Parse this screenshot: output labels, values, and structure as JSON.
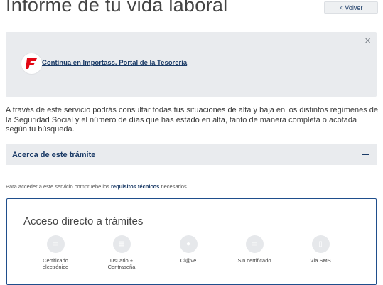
{
  "header": {
    "title": "Informe de tu vida laboral",
    "back_label": "< Volver"
  },
  "notice": {
    "link_text": "Continua en Importass. Portal de la Tesorería",
    "close_icon": "×"
  },
  "description": "A través de este servicio podrás consultar todas tus situaciones de alta y baja en los distintos regímenes de la Seguridad Social y el número de días que has estado en alta, tanto de manera completa o acotada según tu búsqueda.",
  "accordion": {
    "label": "Acerca de este trámite"
  },
  "requirements": {
    "prefix": "Para acceder a este servicio compruebe los ",
    "link": "requisitos técnicos",
    "suffix": " necesarios."
  },
  "access": {
    "title": "Acceso directo a trámites",
    "options": [
      {
        "label": "Certificado electrónico",
        "icon": "certificate-icon",
        "glyph": "▭"
      },
      {
        "label": "Usuario + Contraseña",
        "icon": "user-password-icon",
        "glyph": "▤"
      },
      {
        "label": "Cl@ve",
        "icon": "clave-icon",
        "glyph": "●"
      },
      {
        "label": "Sin certificado",
        "icon": "no-certificate-icon",
        "glyph": "▭"
      },
      {
        "label": "Vía SMS",
        "icon": "sms-icon",
        "glyph": "▯"
      }
    ]
  },
  "colors": {
    "brand_red": "#e30613",
    "navy": "#1a3a66",
    "panel_gray": "#e9ebee",
    "frame_blue": "#1f4e8c"
  }
}
